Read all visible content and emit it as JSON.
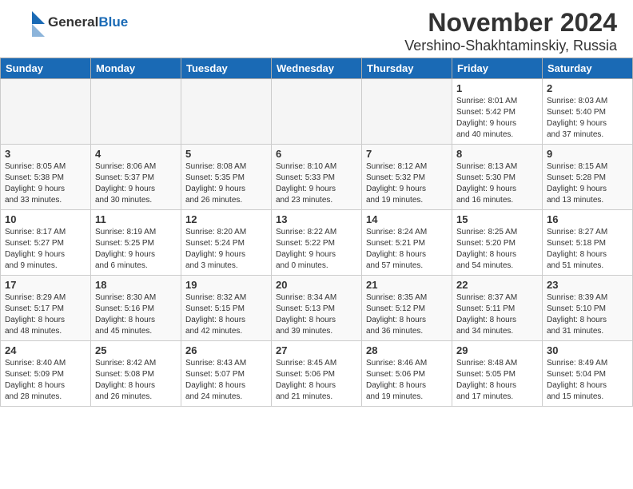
{
  "header": {
    "logo_general": "General",
    "logo_blue": "Blue",
    "month_title": "November 2024",
    "location": "Vershino-Shakhtaminskiy, Russia"
  },
  "weekdays": [
    "Sunday",
    "Monday",
    "Tuesday",
    "Wednesday",
    "Thursday",
    "Friday",
    "Saturday"
  ],
  "weeks": [
    [
      {
        "day": "",
        "info": ""
      },
      {
        "day": "",
        "info": ""
      },
      {
        "day": "",
        "info": ""
      },
      {
        "day": "",
        "info": ""
      },
      {
        "day": "",
        "info": ""
      },
      {
        "day": "1",
        "info": "Sunrise: 8:01 AM\nSunset: 5:42 PM\nDaylight: 9 hours\nand 40 minutes."
      },
      {
        "day": "2",
        "info": "Sunrise: 8:03 AM\nSunset: 5:40 PM\nDaylight: 9 hours\nand 37 minutes."
      }
    ],
    [
      {
        "day": "3",
        "info": "Sunrise: 8:05 AM\nSunset: 5:38 PM\nDaylight: 9 hours\nand 33 minutes."
      },
      {
        "day": "4",
        "info": "Sunrise: 8:06 AM\nSunset: 5:37 PM\nDaylight: 9 hours\nand 30 minutes."
      },
      {
        "day": "5",
        "info": "Sunrise: 8:08 AM\nSunset: 5:35 PM\nDaylight: 9 hours\nand 26 minutes."
      },
      {
        "day": "6",
        "info": "Sunrise: 8:10 AM\nSunset: 5:33 PM\nDaylight: 9 hours\nand 23 minutes."
      },
      {
        "day": "7",
        "info": "Sunrise: 8:12 AM\nSunset: 5:32 PM\nDaylight: 9 hours\nand 19 minutes."
      },
      {
        "day": "8",
        "info": "Sunrise: 8:13 AM\nSunset: 5:30 PM\nDaylight: 9 hours\nand 16 minutes."
      },
      {
        "day": "9",
        "info": "Sunrise: 8:15 AM\nSunset: 5:28 PM\nDaylight: 9 hours\nand 13 minutes."
      }
    ],
    [
      {
        "day": "10",
        "info": "Sunrise: 8:17 AM\nSunset: 5:27 PM\nDaylight: 9 hours\nand 9 minutes."
      },
      {
        "day": "11",
        "info": "Sunrise: 8:19 AM\nSunset: 5:25 PM\nDaylight: 9 hours\nand 6 minutes."
      },
      {
        "day": "12",
        "info": "Sunrise: 8:20 AM\nSunset: 5:24 PM\nDaylight: 9 hours\nand 3 minutes."
      },
      {
        "day": "13",
        "info": "Sunrise: 8:22 AM\nSunset: 5:22 PM\nDaylight: 9 hours\nand 0 minutes."
      },
      {
        "day": "14",
        "info": "Sunrise: 8:24 AM\nSunset: 5:21 PM\nDaylight: 8 hours\nand 57 minutes."
      },
      {
        "day": "15",
        "info": "Sunrise: 8:25 AM\nSunset: 5:20 PM\nDaylight: 8 hours\nand 54 minutes."
      },
      {
        "day": "16",
        "info": "Sunrise: 8:27 AM\nSunset: 5:18 PM\nDaylight: 8 hours\nand 51 minutes."
      }
    ],
    [
      {
        "day": "17",
        "info": "Sunrise: 8:29 AM\nSunset: 5:17 PM\nDaylight: 8 hours\nand 48 minutes."
      },
      {
        "day": "18",
        "info": "Sunrise: 8:30 AM\nSunset: 5:16 PM\nDaylight: 8 hours\nand 45 minutes."
      },
      {
        "day": "19",
        "info": "Sunrise: 8:32 AM\nSunset: 5:15 PM\nDaylight: 8 hours\nand 42 minutes."
      },
      {
        "day": "20",
        "info": "Sunrise: 8:34 AM\nSunset: 5:13 PM\nDaylight: 8 hours\nand 39 minutes."
      },
      {
        "day": "21",
        "info": "Sunrise: 8:35 AM\nSunset: 5:12 PM\nDaylight: 8 hours\nand 36 minutes."
      },
      {
        "day": "22",
        "info": "Sunrise: 8:37 AM\nSunset: 5:11 PM\nDaylight: 8 hours\nand 34 minutes."
      },
      {
        "day": "23",
        "info": "Sunrise: 8:39 AM\nSunset: 5:10 PM\nDaylight: 8 hours\nand 31 minutes."
      }
    ],
    [
      {
        "day": "24",
        "info": "Sunrise: 8:40 AM\nSunset: 5:09 PM\nDaylight: 8 hours\nand 28 minutes."
      },
      {
        "day": "25",
        "info": "Sunrise: 8:42 AM\nSunset: 5:08 PM\nDaylight: 8 hours\nand 26 minutes."
      },
      {
        "day": "26",
        "info": "Sunrise: 8:43 AM\nSunset: 5:07 PM\nDaylight: 8 hours\nand 24 minutes."
      },
      {
        "day": "27",
        "info": "Sunrise: 8:45 AM\nSunset: 5:06 PM\nDaylight: 8 hours\nand 21 minutes."
      },
      {
        "day": "28",
        "info": "Sunrise: 8:46 AM\nSunset: 5:06 PM\nDaylight: 8 hours\nand 19 minutes."
      },
      {
        "day": "29",
        "info": "Sunrise: 8:48 AM\nSunset: 5:05 PM\nDaylight: 8 hours\nand 17 minutes."
      },
      {
        "day": "30",
        "info": "Sunrise: 8:49 AM\nSunset: 5:04 PM\nDaylight: 8 hours\nand 15 minutes."
      }
    ]
  ]
}
